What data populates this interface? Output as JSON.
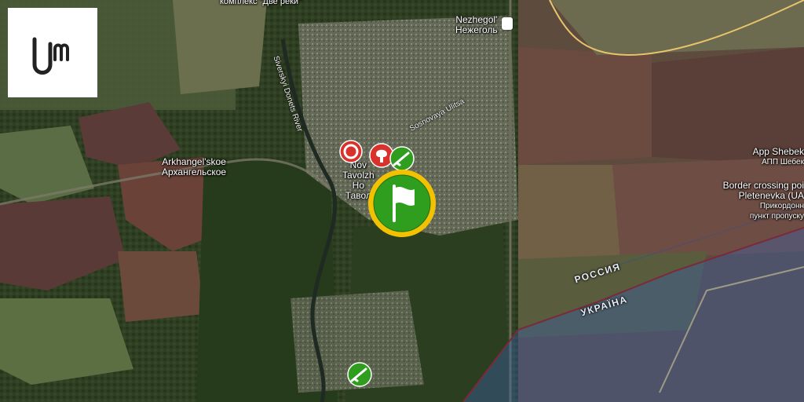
{
  "map": {
    "places": [
      {
        "id": "nezhegol",
        "latin": "Nezhegol'",
        "cyrillic": "Нежеголь"
      },
      {
        "id": "arkhangelskoe",
        "latin": "Arkhangel'skoe",
        "cyrillic": "Архангельское"
      },
      {
        "id": "novaya_tavolzhanka",
        "line1": "Nov",
        "line2": "Tavolzh",
        "line3": "Ho",
        "line4": "Тавол"
      },
      {
        "id": "app_shebekino",
        "latin": "App Shebek",
        "cyrillic": "АПП Шебек"
      },
      {
        "id": "pletenevka",
        "line1": "Border crossing poi",
        "line2": "Pletenevka (UA",
        "line3": "Прикордонн",
        "line4": "пункт пропуску"
      },
      {
        "id": "dve_reki",
        "text": "комплекс \"Две реки\""
      }
    ],
    "roads": [
      {
        "id": "siverskyi",
        "text": "Siverskyi Donets River"
      },
      {
        "id": "sosnovaya",
        "text": "Sosnovaya Ulitsa"
      }
    ],
    "border_labels": {
      "russia": "РОССИЯ",
      "ukraine": "УКРАЇНА"
    },
    "markers": [
      {
        "id": "lifebuoy",
        "icon": "lifebuoy-icon",
        "color": "#d9312c"
      },
      {
        "id": "explosion",
        "icon": "explosion-icon",
        "color": "#d9312c"
      },
      {
        "id": "rifle_north",
        "icon": "rifle-icon",
        "color": "#2f9e1f"
      },
      {
        "id": "flag_main",
        "icon": "flag-icon",
        "color": "#2f9e1f",
        "ring": "#f2c200"
      },
      {
        "id": "rifle_south",
        "icon": "rifle-icon",
        "color": "#2f9e1f"
      }
    ],
    "colors": {
      "ukraine_overlay": "#3a5fa8",
      "border_line": "#7a2a3a",
      "road": "#e8c46a"
    }
  }
}
